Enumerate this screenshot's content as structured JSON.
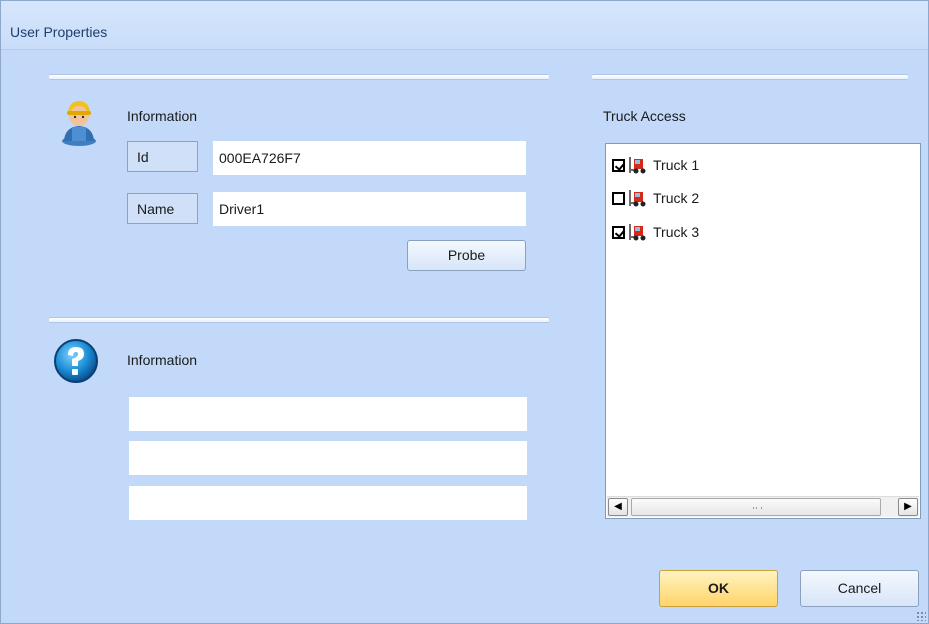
{
  "window": {
    "title": "User Properties"
  },
  "user_section": {
    "heading": "Information",
    "id_label": "Id",
    "id_value": "000EA726F7",
    "name_label": "Name",
    "name_value": "Driver1",
    "probe_button": "Probe"
  },
  "info_section": {
    "heading": "Information",
    "fields": [
      "",
      "",
      ""
    ]
  },
  "truck_access": {
    "heading": "Truck Access",
    "items": [
      {
        "label": "Truck 1",
        "checked": true
      },
      {
        "label": "Truck 2",
        "checked": false
      },
      {
        "label": "Truck 3",
        "checked": true
      }
    ]
  },
  "buttons": {
    "ok": "OK",
    "cancel": "Cancel"
  },
  "icons": {
    "user": "user-worker-icon",
    "help": "help-question-icon",
    "truck": "forklift-truck-icon",
    "scroll_left": "scroll-left-arrow-icon",
    "scroll_right": "scroll-right-arrow-icon"
  },
  "colors": {
    "background": "#c3d9f9",
    "ok_button": "#ffd46a",
    "title_text": "#1e3f6e"
  }
}
